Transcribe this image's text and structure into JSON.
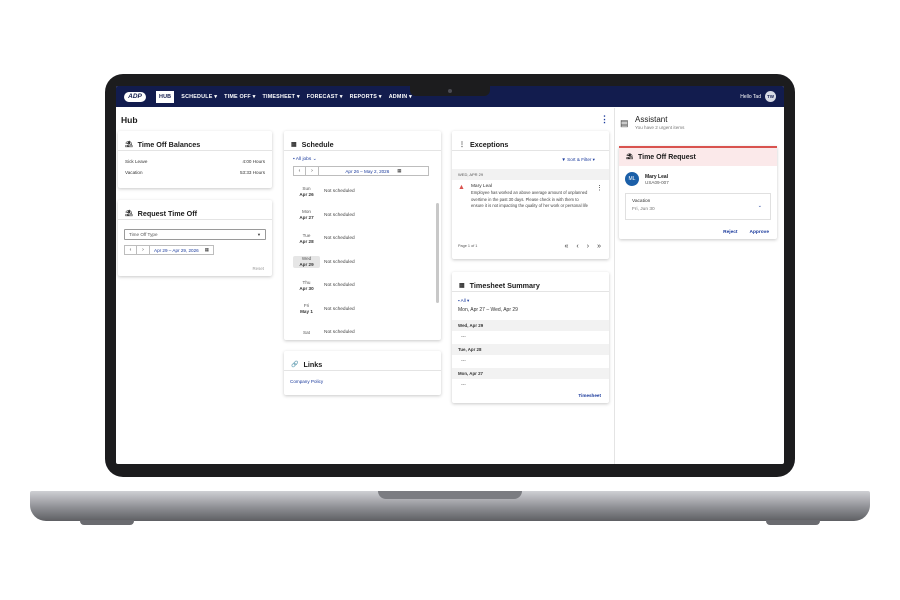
{
  "nav": {
    "logo": "ADP",
    "items": [
      "HUB",
      "SCHEDULE ▾",
      "TIME OFF ▾",
      "TIMESHEET ▾",
      "FORECAST ▾",
      "REPORTS ▾",
      "ADMIN ▾"
    ],
    "greeting": "Hello Tad",
    "avatar_initials": "TW"
  },
  "page": {
    "title": "Hub"
  },
  "time_off_balances": {
    "title": "Time Off Balances",
    "rows": [
      {
        "label": "Sick Leave",
        "value": "4:00 Hours"
      },
      {
        "label": "Vacation",
        "value": "53:33 Hours"
      }
    ]
  },
  "request_time_off": {
    "title": "Request Time Off",
    "type_placeholder": "Time Off Type",
    "date_range": "Apr 29 – Apr 29, 2026",
    "reset": "Reset"
  },
  "schedule": {
    "title": "Schedule",
    "filter": "All jobs",
    "date_range": "Apr 26 – May 2, 2026",
    "days": [
      {
        "dow": "Sun",
        "date": "Apr 26",
        "status": "Not scheduled"
      },
      {
        "dow": "Mon",
        "date": "Apr 27",
        "status": "Not scheduled"
      },
      {
        "dow": "Tue",
        "date": "Apr 28",
        "status": "Not scheduled"
      },
      {
        "dow": "Wed",
        "date": "Apr 29",
        "status": "Not scheduled"
      },
      {
        "dow": "Thu",
        "date": "Apr 30",
        "status": "Not scheduled"
      },
      {
        "dow": "Fri",
        "date": "May 1",
        "status": "Not scheduled"
      },
      {
        "dow": "Sat",
        "date": "",
        "status": "Not scheduled"
      }
    ]
  },
  "links": {
    "title": "Links",
    "items": [
      "Company Policy"
    ]
  },
  "exceptions": {
    "title": "Exceptions",
    "sort_filter": "Sort & Filter",
    "group_date": "WED, APR 29",
    "item_name": "Mary Leal",
    "item_text": "Employee has worked an above average amount of unplanned overtime in the past 30 days. Please check in with them to ensure it is not impacting the quality of her work or personal life",
    "pager": "Page 1 of 1"
  },
  "timesheet_summary": {
    "title": "Timesheet Summary",
    "filter": "All",
    "range": "Mon, Apr 27 – Wed, Apr 29",
    "days": [
      {
        "date": "Wed, Apr 29",
        "value": "---"
      },
      {
        "date": "Tue, Apr 28",
        "value": "---"
      },
      {
        "date": "Mon, Apr 27",
        "value": "---"
      }
    ],
    "link": "Timesheet"
  },
  "assistant": {
    "title": "Assistant",
    "subtitle": "You have 2 urgent items",
    "card_title": "Time Off Request",
    "person_initials": "ML",
    "person_name": "Mary Leal",
    "person_id": "USA09-007",
    "type": "Vacation",
    "date": "Fri, Jun 30",
    "reject": "Reject",
    "approve": "Approve"
  },
  "colors": {
    "nav_bg": "#121c4e",
    "accent_blue": "#1a3a9c",
    "warning": "#d9534f",
    "request_header_bg": "#fbe9ea"
  }
}
